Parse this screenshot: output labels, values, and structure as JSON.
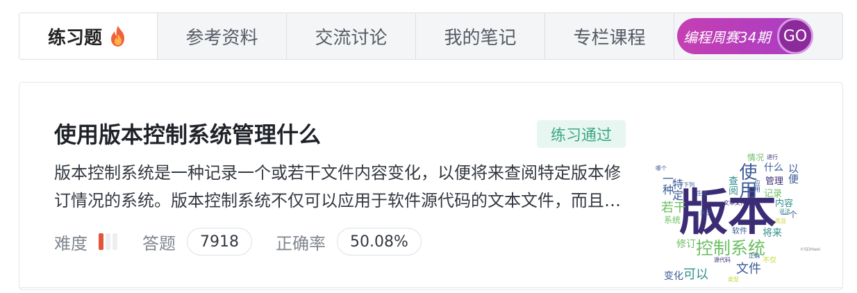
{
  "tabs": [
    {
      "label": "练习题",
      "active": true,
      "icon": "fire-icon"
    },
    {
      "label": "参考资料",
      "active": false
    },
    {
      "label": "交流讨论",
      "active": false
    },
    {
      "label": "我的笔记",
      "active": false
    },
    {
      "label": "专栏课程",
      "active": false
    }
  ],
  "promo": {
    "label": "编程周赛34期",
    "button": "GO"
  },
  "question": {
    "title": "使用版本控制系统管理什么",
    "status": "练习通过",
    "description": "版本控制系统是一种记录一个或若干文件内容变化，以便将来查阅特定版本修订情况的系统。版本控制系统不仅可以应用于软件源代码的文本文件，而且可以对任何类型的文件进行版本控制。",
    "difficulty_label": "难度",
    "difficulty_level": 1,
    "difficulty_max": 3,
    "answers_label": "答题",
    "answers_count": "7918",
    "accuracy_label": "正确率",
    "accuracy": "50.08%"
  },
  "wordcloud": {
    "words": [
      "版本",
      "控制系统",
      "使用",
      "一种",
      "若干",
      "特定",
      "系统",
      "文件",
      "变化",
      "可以",
      "修订",
      "将来",
      "查阅",
      "管理",
      "什么",
      "以便",
      "情况",
      "记录",
      "内容",
      "一个",
      "软件",
      "进行",
      "应用",
      "下列",
      "任何",
      "哪个",
      "文本文件",
      "源代码",
      "不仅",
      "正确",
      "类型",
      "而且",
      "说法",
      "关于",
      "©SDHwei"
    ],
    "colors": {
      "primary": "#3b2c75",
      "green": "#6cbf63",
      "teal": "#2d8f8a",
      "blue": "#3a5a96",
      "yellow": "#c9d435"
    }
  },
  "colors": {
    "tab_bg": "#f3f5f7",
    "promo_gradient_start": "#c53fb3",
    "promo_gradient_end": "#a83dc4",
    "status_green": "#3aa882",
    "difficulty_red": "#e3553a"
  }
}
